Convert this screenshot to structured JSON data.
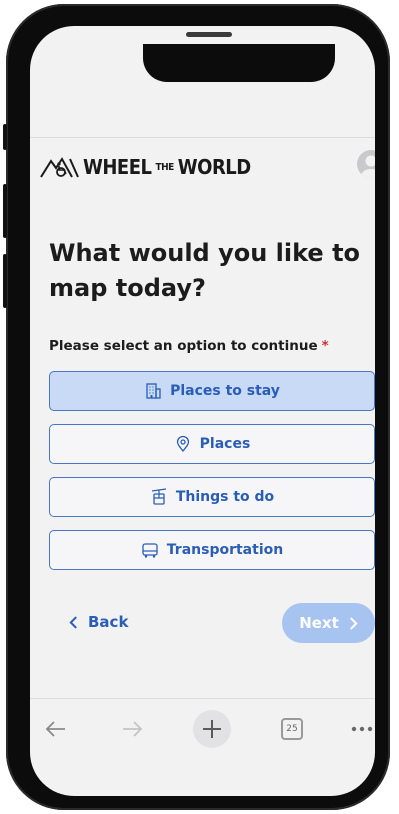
{
  "brand": {
    "word1": "WHEEL",
    "word2": "THE",
    "word3": "WORLD"
  },
  "header": {
    "avatar_icon": "user-avatar-icon"
  },
  "page": {
    "title": "What would you like to map today?",
    "prompt": "Please select an option to continue",
    "required_mark": "*"
  },
  "options": [
    {
      "label": "Places to stay",
      "icon": "building-icon",
      "selected": true
    },
    {
      "label": "Places",
      "icon": "map-pin-icon",
      "selected": false
    },
    {
      "label": "Things to do",
      "icon": "cable-car-icon",
      "selected": false
    },
    {
      "label": "Transportation",
      "icon": "bus-icon",
      "selected": false
    }
  ],
  "nav": {
    "back_label": "Back",
    "next_label": "Next"
  },
  "browser": {
    "tab_count": "25"
  },
  "colors": {
    "accent": "#2a5db6",
    "selected_bg": "#c8daf6",
    "next_disabled": "#a7c3f0",
    "required": "#d03030"
  }
}
